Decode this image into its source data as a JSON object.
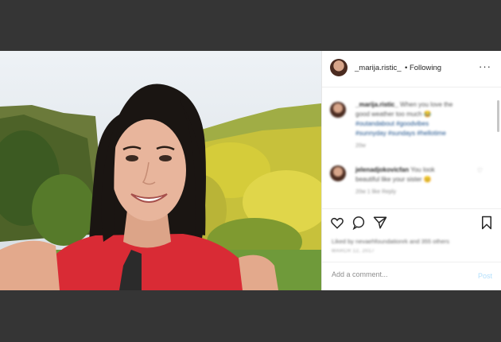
{
  "post": {
    "username": "_marija.ristic_",
    "following": "• Following",
    "more": "···"
  },
  "comments": [
    {
      "user": "_marija.ristic_",
      "text_lines": [
        "When you love the",
        "good weather too much 😂",
        "#outandabout #goodvibes",
        "#sunnyday #sundays #hellotime"
      ],
      "meta": "20w"
    },
    {
      "user": "jelenadjokovicfan",
      "text_lines": [
        "You look",
        "beautiful like your sister 😊"
      ],
      "meta": "20w   1 like   Reply"
    }
  ],
  "actions": {
    "likes": "Liked by nevaehfoundationrk and 355 others",
    "date": "MARCH 12, 2017"
  },
  "add_comment": {
    "placeholder": "Add a comment...",
    "post_label": "Post"
  },
  "icons": [
    "heart-icon",
    "comment-icon",
    "share-icon",
    "bookmark-icon",
    "more-icon"
  ],
  "colors": {
    "post_button": "#b2dffc",
    "background": "#353535"
  }
}
